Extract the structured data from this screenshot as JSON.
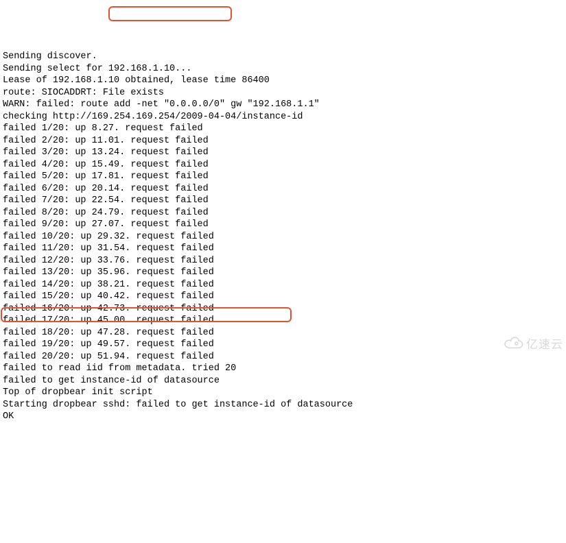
{
  "lines": [
    "Sending discover.",
    "Sending select for 192.168.1.10...",
    "Lease of 192.168.1.10 obtained, lease time 86400",
    "route: SIOCADDRT: File exists",
    "WARN: failed: route add -net \"0.0.0.0/0\" gw \"192.168.1.1\"",
    "checking http://169.254.169.254/2009-04-04/instance-id",
    "failed 1/20: up 8.27. request failed",
    "failed 2/20: up 11.01. request failed",
    "failed 3/20: up 13.24. request failed",
    "failed 4/20: up 15.49. request failed",
    "failed 5/20: up 17.81. request failed",
    "failed 6/20: up 20.14. request failed",
    "failed 7/20: up 22.54. request failed",
    "failed 8/20: up 24.79. request failed",
    "failed 9/20: up 27.07. request failed",
    "failed 10/20: up 29.32. request failed",
    "failed 11/20: up 31.54. request failed",
    "failed 12/20: up 33.76. request failed",
    "failed 13/20: up 35.96. request failed",
    "failed 14/20: up 38.21. request failed",
    "failed 15/20: up 40.42. request failed",
    "failed 16/20: up 42.73. request failed",
    "failed 17/20: up 45.00. request failed",
    "failed 18/20: up 47.28. request failed",
    "failed 19/20: up 49.57. request failed",
    "failed 20/20: up 51.94. request failed",
    "failed to read iid from metadata. tried 20",
    "failed to get instance-id of datasource",
    "Top of dropbear init script",
    "Starting dropbear sshd: failed to get instance-id of datasource",
    "OK"
  ],
  "watermark": "亿速云"
}
